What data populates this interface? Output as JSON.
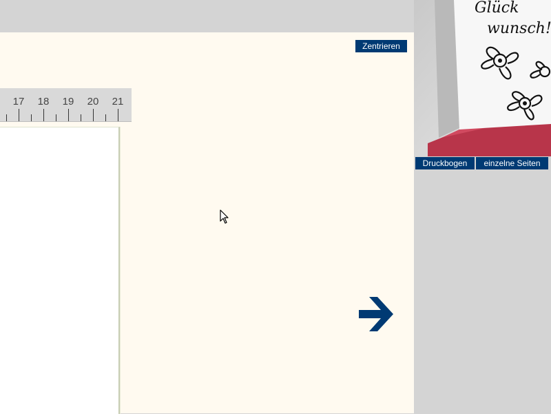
{
  "workspace": {
    "center_button": "Zentrieren"
  },
  "ruler": {
    "labels": [
      "17",
      "18",
      "19",
      "20",
      "21"
    ]
  },
  "preview": {
    "card_text": "Glückwunsch!",
    "card_text_line1": "Glück",
    "card_text_line2": "wunsch!",
    "druckbogen_label": "Druckbogen",
    "einzelne_seiten_label": "einzelne Seiten"
  },
  "colors": {
    "accent": "#003a73",
    "workspace_bg": "#fffaf0",
    "chrome_bg": "#d4d4d4",
    "envelope": "#c23a4f"
  },
  "icons": {
    "next": "arrow-right-icon",
    "cursor": "mouse-pointer-icon"
  }
}
